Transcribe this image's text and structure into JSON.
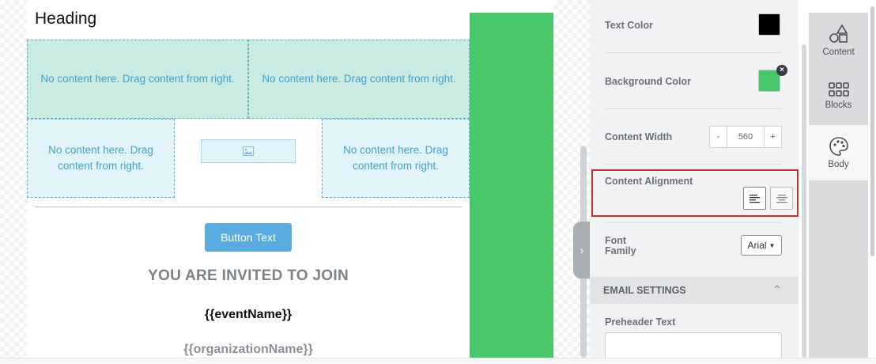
{
  "canvas": {
    "heading": "Heading",
    "drop_hint": "No content here. Drag content from right.",
    "button_text": "Button Text",
    "invite_text": "YOU ARE INVITED TO JOIN",
    "event_name": "{{eventName}}",
    "organization_name": "{{organizationName}}"
  },
  "settings": {
    "text_color_label": "Text Color",
    "text_color_value": "#000000",
    "background_color_label": "Background Color",
    "background_color_value": "#48c76b",
    "content_width_label": "Content Width",
    "content_width_value": "560",
    "content_width_minus": "-",
    "content_width_plus": "+",
    "content_alignment_label": "Content Alignment",
    "font_family_label": "Font Family",
    "font_family_value": "Arial",
    "email_settings_header": "EMAIL SETTINGS",
    "preheader_label": "Preheader Text",
    "preheader_value": ""
  },
  "tabs": [
    {
      "label": "Content",
      "icon": "shapes-icon"
    },
    {
      "label": "Blocks",
      "icon": "grid-icon"
    },
    {
      "label": "Body",
      "icon": "palette-icon",
      "active": true
    }
  ],
  "colors": {
    "accent_green": "#48c76b",
    "highlight_red": "#cc2b2b",
    "drop_blue": "#3ea3cf"
  }
}
